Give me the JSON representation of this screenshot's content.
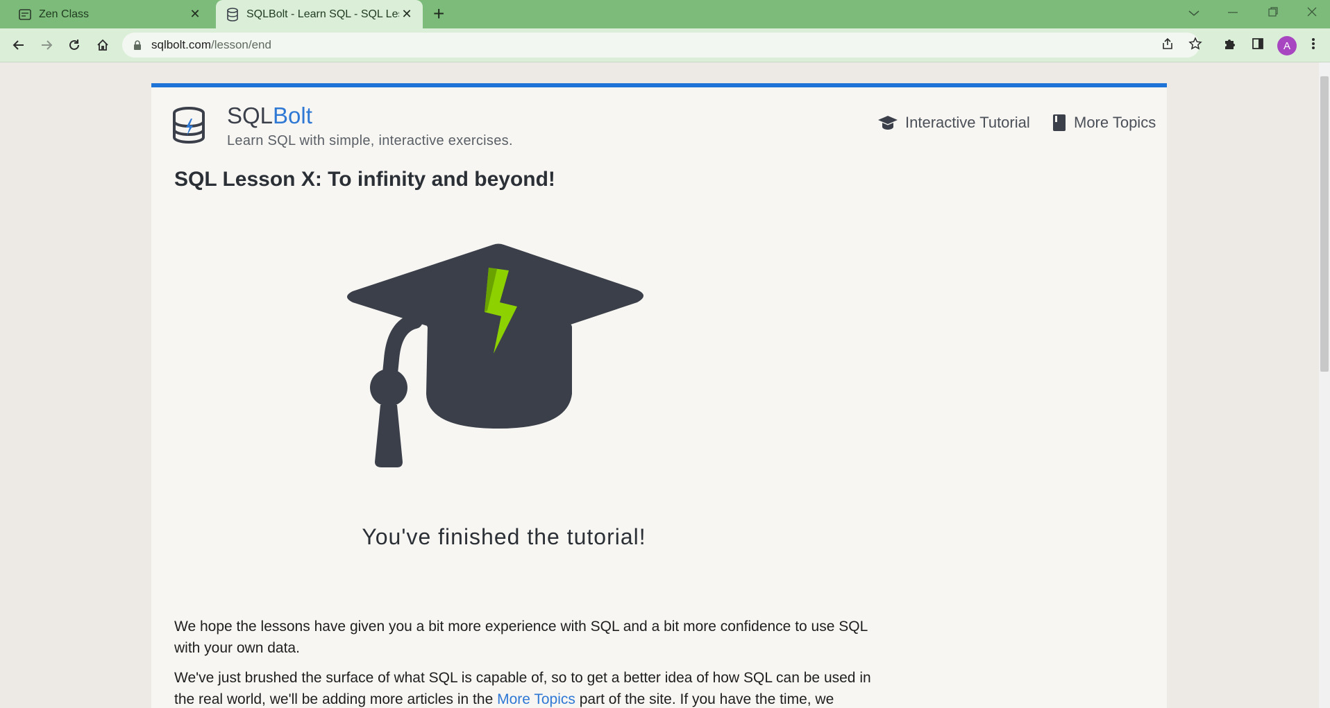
{
  "browser": {
    "tabs": [
      {
        "title": "Zen Class",
        "active": false
      },
      {
        "title": "SQLBolt - Learn SQL - SQL Lesson X: To infinity and beyond!",
        "active": true
      }
    ],
    "url_host": "sqlbolt.com",
    "url_path": "/lesson/end",
    "avatar_letter": "A",
    "colors": {
      "tabstrip": "#7dbb7a",
      "toolbar": "#dbefd8",
      "avatar": "#a746c0"
    }
  },
  "site": {
    "brand_prefix": "SQL",
    "brand_accent": "Bolt",
    "tagline": "Learn SQL with simple, interactive exercises.",
    "nav": [
      {
        "label": "Interactive Tutorial",
        "icon": "graduation-cap-icon"
      },
      {
        "label": "More Topics",
        "icon": "book-icon"
      }
    ],
    "colors": {
      "accent": "#2f78d4",
      "top_border": "#1e74d6",
      "bolt": "#8ed100"
    }
  },
  "lesson": {
    "title": "SQL Lesson X: To infinity and beyond!",
    "finished_caption": "You've finished the tutorial!",
    "paragraph1": "We hope the lessons have given you a bit more experience with SQL and a bit more confidence to use SQL with your own data.",
    "paragraph2_before": "We've just brushed the surface of what SQL is capable of, so to get a better idea of how SQL can be used in the real world, we'll be adding more articles in the ",
    "paragraph2_link": "More Topics",
    "paragraph2_after": " part of the site. If you have the time, we recommend that you continue to dive deeper into SQL!"
  }
}
